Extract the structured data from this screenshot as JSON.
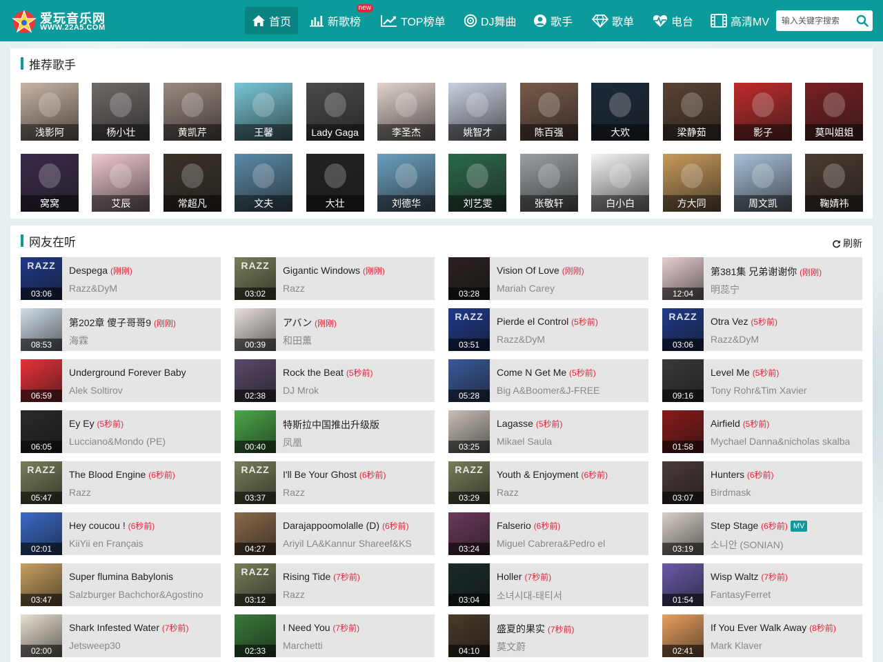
{
  "header": {
    "logo_title": "爱玩音乐网",
    "logo_sub": "WWW.22A5.COM",
    "nav": [
      {
        "label": "首页",
        "icon": "home-icon"
      },
      {
        "label": "新歌榜",
        "icon": "bar-chart-icon",
        "badge": "new"
      },
      {
        "label": "TOP榜单",
        "icon": "trend-icon"
      },
      {
        "label": "DJ舞曲",
        "icon": "disc-icon"
      },
      {
        "label": "歌手",
        "icon": "user-icon"
      },
      {
        "label": "歌单",
        "icon": "diamond-icon"
      },
      {
        "label": "电台",
        "icon": "heart-pulse-icon"
      },
      {
        "label": "高清MV",
        "icon": "film-icon"
      }
    ],
    "search_placeholder": "输入关键字搜索"
  },
  "singers": {
    "title": "推荐歌手",
    "items": [
      {
        "name": "浅影阿",
        "color": "#c8b4a4"
      },
      {
        "name": "杨小壮",
        "color": "#6f6a68"
      },
      {
        "name": "黄凯芹",
        "color": "#9c8a80"
      },
      {
        "name": "王馨",
        "color": "#77c6d6"
      },
      {
        "name": "Lady Gaga",
        "color": "#4a4a4a"
      },
      {
        "name": "李圣杰",
        "color": "#e2d2cc"
      },
      {
        "name": "姚智才",
        "color": "#c9d0e0"
      },
      {
        "name": "陈百强",
        "color": "#7a5a4a"
      },
      {
        "name": "大欢",
        "color": "#1a2a3a"
      },
      {
        "name": "梁静茹",
        "color": "#5a4232"
      },
      {
        "name": "影子",
        "color": "#c02a2a"
      },
      {
        "name": "莫叫姐姐",
        "color": "#7a1e22"
      },
      {
        "name": "窝窝",
        "color": "#3a2a4a"
      },
      {
        "name": "艾辰",
        "color": "#f0c8d0"
      },
      {
        "name": "常超凡",
        "color": "#3a3228"
      },
      {
        "name": "文夫",
        "color": "#5a8aa8"
      },
      {
        "name": "大壮",
        "color": "#222222"
      },
      {
        "name": "刘德华",
        "color": "#6aa0c0"
      },
      {
        "name": "刘艺雯",
        "color": "#2a6a4a"
      },
      {
        "name": "张敬轩",
        "color": "#9aa0a2"
      },
      {
        "name": "白小白",
        "color": "#f4f4f4"
      },
      {
        "name": "方大同",
        "color": "#c89a5a"
      },
      {
        "name": "周文凯",
        "color": "#a8c0d8"
      },
      {
        "name": "鞠婧祎",
        "color": "#4a3a30"
      }
    ]
  },
  "listening": {
    "title": "网友在听",
    "refresh_label": "刷新",
    "songs": [
      {
        "title": "Despega",
        "ago": "(刚刚)",
        "artist": "Razz&DyM",
        "duration": "03:06",
        "color": "#1f3a8a",
        "art": "RAZZ"
      },
      {
        "title": "Gigantic Windows",
        "ago": "(刚刚)",
        "artist": "Razz",
        "duration": "03:02",
        "color": "#7a7d5a",
        "art": "RAZZ"
      },
      {
        "title": "Vision Of Love",
        "ago": "(刚刚)",
        "artist": "Mariah Carey",
        "duration": "03:28",
        "color": "#2a2220",
        "art": ""
      },
      {
        "title": "第381集 兄弟谢谢你",
        "ago": "(刚刚)",
        "artist": "明蕊宁",
        "duration": "12:04",
        "color": "#e8cfd0",
        "art": ""
      },
      {
        "title": "第202章 傻子哥哥9",
        "ago": "(刚刚)",
        "artist": "海霖",
        "duration": "08:53",
        "color": "#d0dde8",
        "art": ""
      },
      {
        "title": "アバン",
        "ago": "(刚刚)",
        "artist": "和田薫",
        "duration": "00:39",
        "color": "#e8e0dc",
        "art": ""
      },
      {
        "title": "Pierde el Control",
        "ago": "(5秒前)",
        "artist": "Razz&DyM",
        "duration": "03:51",
        "color": "#1f3a8a",
        "art": "RAZZ"
      },
      {
        "title": "Otra Vez",
        "ago": "(5秒前)",
        "artist": "Razz&DyM",
        "duration": "03:06",
        "color": "#1f3a8a",
        "art": "RAZZ"
      },
      {
        "title": "Underground Forever Baby",
        "ago": "",
        "artist": "Alek Soltirov",
        "duration": "06:59",
        "color": "#e8313a",
        "art": ""
      },
      {
        "title": "Rock the Beat",
        "ago": "(5秒前)",
        "artist": "DJ Mrok",
        "duration": "02:38",
        "color": "#5a4a6a",
        "art": ""
      },
      {
        "title": "Come N Get Me",
        "ago": "(5秒前)",
        "artist": "Big A&Boomer&J-FREE",
        "duration": "05:28",
        "color": "#3a5a9a",
        "art": ""
      },
      {
        "title": "Level Me",
        "ago": "(5秒前)",
        "artist": "Tony Rohr&Tim Xavier",
        "duration": "09:16",
        "color": "#3a3a3a",
        "art": ""
      },
      {
        "title": "Ey Ey",
        "ago": "(5秒前)",
        "artist": "Lucciano&Mondo (PE)",
        "duration": "06:05",
        "color": "#2a2a2a",
        "art": ""
      },
      {
        "title": "特斯拉中国推出升级版",
        "ago": "",
        "artist": "凤凰",
        "duration": "00:40",
        "color": "#4aa84a",
        "art": ""
      },
      {
        "title": "Lagasse",
        "ago": "(5秒前)",
        "artist": "Mikael Saula",
        "duration": "03:25",
        "color": "#c8c0b8",
        "art": ""
      },
      {
        "title": "Airfield",
        "ago": "(5秒前)",
        "artist": "Mychael Danna&nicholas skalba",
        "duration": "01:58",
        "color": "#8a1a1a",
        "art": ""
      },
      {
        "title": "The Blood Engine",
        "ago": "(6秒前)",
        "artist": "Razz",
        "duration": "05:47",
        "color": "#7a7d5a",
        "art": "RAZZ"
      },
      {
        "title": "I'll Be Your Ghost",
        "ago": "(6秒前)",
        "artist": "Razz",
        "duration": "03:37",
        "color": "#7a7d5a",
        "art": "RAZZ"
      },
      {
        "title": "Youth & Enjoyment",
        "ago": "(6秒前)",
        "artist": "Razz",
        "duration": "03:29",
        "color": "#7a7d5a",
        "art": "RAZZ"
      },
      {
        "title": "Hunters",
        "ago": "(6秒前)",
        "artist": "Birdmask",
        "duration": "03:07",
        "color": "#4a3a38",
        "art": ""
      },
      {
        "title": "Hey coucou !",
        "ago": "(6秒前)",
        "artist": "KiiYii en Français",
        "duration": "02:01",
        "color": "#3a6ac8",
        "art": ""
      },
      {
        "title": "Darajappoomolalle (D)",
        "ago": "(6秒前)",
        "artist": "Ariyil LA&Kannur Shareef&KS",
        "duration": "04:27",
        "color": "#8a6a4a",
        "art": ""
      },
      {
        "title": "Falserio",
        "ago": "(6秒前)",
        "artist": "Miguel Cabrera&Pedro el",
        "duration": "03:24",
        "color": "#6a3a5a",
        "art": ""
      },
      {
        "title": "Step Stage",
        "ago": "(6秒前)",
        "artist": "소니안 (SONIAN)",
        "duration": "03:19",
        "color": "#d8d0c8",
        "art": "",
        "mv": "MV"
      },
      {
        "title": "Super flumina Babylonis",
        "ago": "",
        "artist": "Salzburger Bachchor&Agostino",
        "duration": "03:47",
        "color": "#c8a060",
        "art": ""
      },
      {
        "title": "Rising Tide",
        "ago": "(7秒前)",
        "artist": "Razz",
        "duration": "03:12",
        "color": "#7a7d5a",
        "art": "RAZZ"
      },
      {
        "title": "Holler",
        "ago": "(7秒前)",
        "artist": "소녀시대-태티서",
        "duration": "03:04",
        "color": "#1a2a2a",
        "art": ""
      },
      {
        "title": "Wisp Waltz",
        "ago": "(7秒前)",
        "artist": "FantasyFerret",
        "duration": "01:54",
        "color": "#6a5aa8",
        "art": ""
      },
      {
        "title": "Shark Infested Water",
        "ago": "(7秒前)",
        "artist": "Jetsweep30",
        "duration": "02:00",
        "color": "#e8e0d0",
        "art": ""
      },
      {
        "title": "I Need You",
        "ago": "(7秒前)",
        "artist": "Marchetti",
        "duration": "02:33",
        "color": "#3a7a3a",
        "art": ""
      },
      {
        "title": "盛夏的果实",
        "ago": "(7秒前)",
        "artist": "莫文蔚",
        "duration": "04:10",
        "color": "#4a3a2a",
        "art": ""
      },
      {
        "title": "If You Ever Walk Away",
        "ago": "(8秒前)",
        "artist": "Mark Klaver",
        "duration": "02:41",
        "color": "#e8a060",
        "art": ""
      }
    ]
  }
}
